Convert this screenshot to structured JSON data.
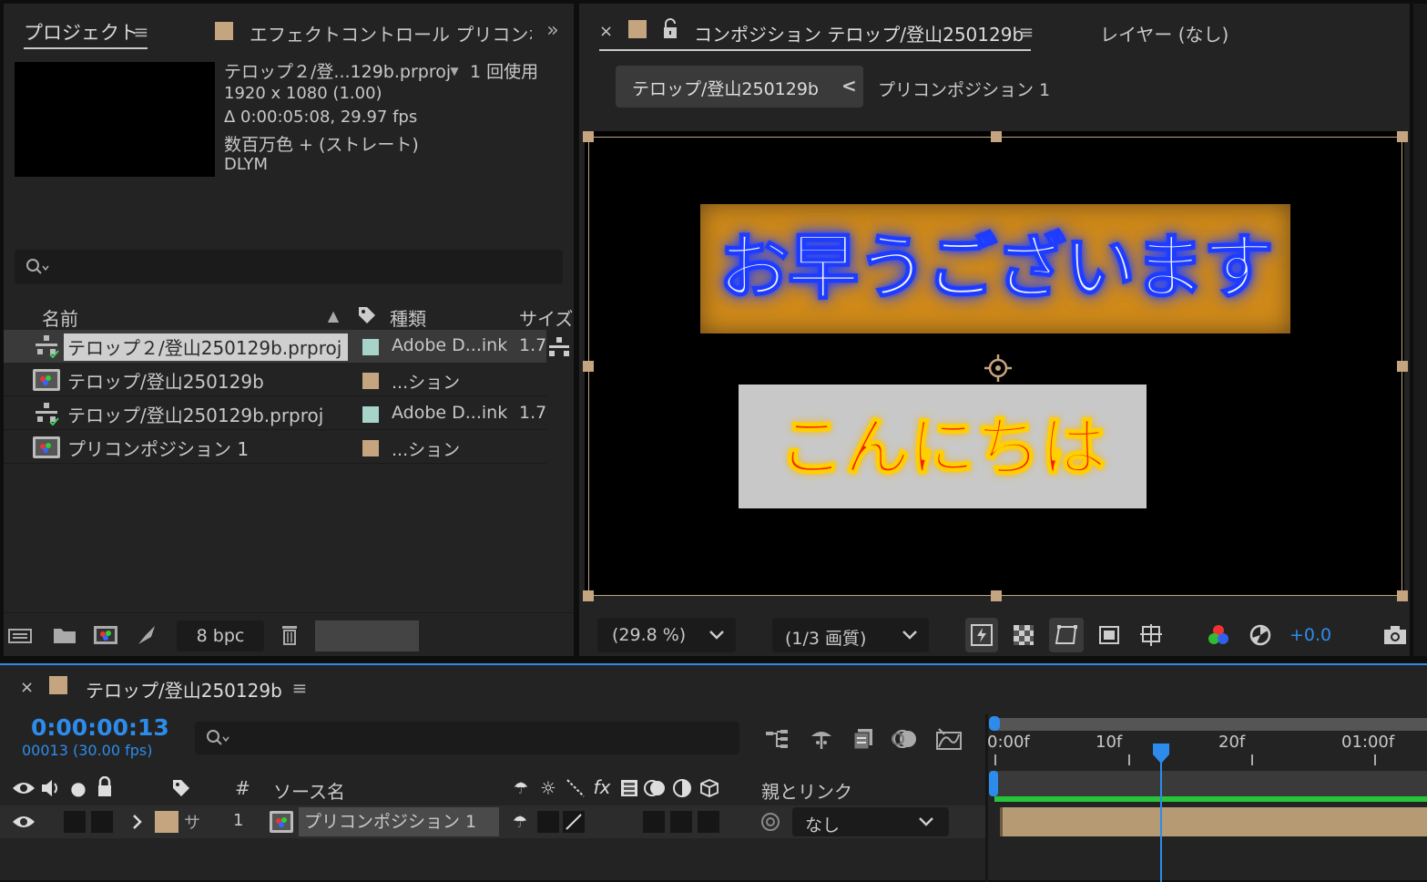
{
  "colors": {
    "panel": "#232323",
    "accent_blue": "#2d8ceb",
    "comp_label": "#c5a57f",
    "footage_label": "#a7d3c9",
    "text_blue": "#1e3cff",
    "text_red": "#ff1a00",
    "box_orange": "#d08a18",
    "box_gray": "#c8c8c8"
  },
  "project": {
    "tab_label": "プロジェクト",
    "effects_tab_label": "エフェクトコントロール プリコンポジシ",
    "info": {
      "name": "テロップ２/登...129b.prproj",
      "usage": "1 回使用",
      "resolution": "1920 x 1080 (1.00)",
      "duration": "Δ 0:00:05:08, 29.97 fps",
      "color": "数百万色 + (ストレート)",
      "codec": "DLYM"
    },
    "search_placeholder": "",
    "columns": {
      "name": "名前",
      "type": "種類",
      "size": "サイズ"
    },
    "items": [
      {
        "name": "テロップ２/登山250129b.prproj",
        "type": "Adobe D...ink",
        "size": "1.7",
        "icon": "dynamic-link-icon",
        "label_color": "#a7d3c9",
        "selected": true
      },
      {
        "name": "テロップ/登山250129b",
        "type": "...ション",
        "size": "",
        "icon": "composition-icon",
        "label_color": "#c5a57f",
        "selected": false
      },
      {
        "name": "テロップ/登山250129b.prproj",
        "type": "Adobe D...ink",
        "size": "1.7",
        "icon": "dynamic-link-icon",
        "label_color": "#a7d3c9",
        "selected": false
      },
      {
        "name": "プリコンポジション 1",
        "type": "...ション",
        "size": "",
        "icon": "composition-icon",
        "label_color": "#c5a57f",
        "selected": false
      }
    ],
    "bpc": "8 bpc"
  },
  "comp": {
    "tab_close": "×",
    "tab_label": "コンポジション テロップ/登山250129b",
    "layer_tab_label": "レイヤー (なし)",
    "breadcrumb_active": "テロップ/登山250129b",
    "breadcrumb_arrow": "<",
    "breadcrumb_next": "プリコンポジション 1",
    "text1": "お早うございます",
    "text2": "こんにちは",
    "zoom": "(29.8 %)",
    "quality": "(1/3 画質)",
    "exposure": "+0.0"
  },
  "timeline": {
    "tab_close": "×",
    "tab_label": "テロップ/登山250129b",
    "timecode": "0:00:00:13",
    "frame_info": "00013 (30.00 fps)",
    "columns": {
      "hash": "#",
      "source": "ソース名",
      "parent": "親とリンク"
    },
    "ruler": [
      "0:00f",
      "10f",
      "20f",
      "01:00f"
    ],
    "playhead_frame": 13,
    "layers": [
      {
        "number": "1",
        "short": "サ",
        "name": "プリコンポジション 1",
        "parent": "なし"
      }
    ]
  }
}
